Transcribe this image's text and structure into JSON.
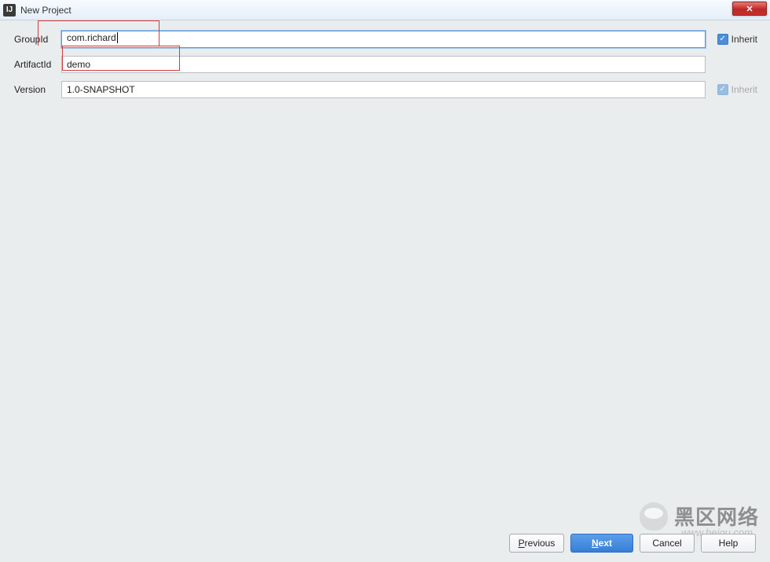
{
  "window": {
    "title": "New Project",
    "icon_letter": "IJ"
  },
  "form": {
    "groupId": {
      "label": "GroupId",
      "value": "com.richard",
      "inherit_label": "Inherit",
      "inherit_checked": true,
      "inherit_enabled": true,
      "focused": true
    },
    "artifactId": {
      "label": "ArtifactId",
      "value": "demo",
      "inherit_label": "",
      "inherit_checked": false,
      "inherit_enabled": false,
      "focused": false
    },
    "version": {
      "label": "Version",
      "value": "1.0-SNAPSHOT",
      "inherit_label": "Inherit",
      "inherit_checked": true,
      "inherit_enabled": false,
      "focused": false
    }
  },
  "buttons": {
    "previous": {
      "pre": "",
      "m": "P",
      "post": "revious"
    },
    "next": {
      "pre": "",
      "m": "N",
      "post": "ext"
    },
    "cancel": {
      "label": "Cancel"
    },
    "help": {
      "label": "Help"
    }
  },
  "watermark": {
    "cn": "黑区网络",
    "url": "www.heiqu.com"
  }
}
